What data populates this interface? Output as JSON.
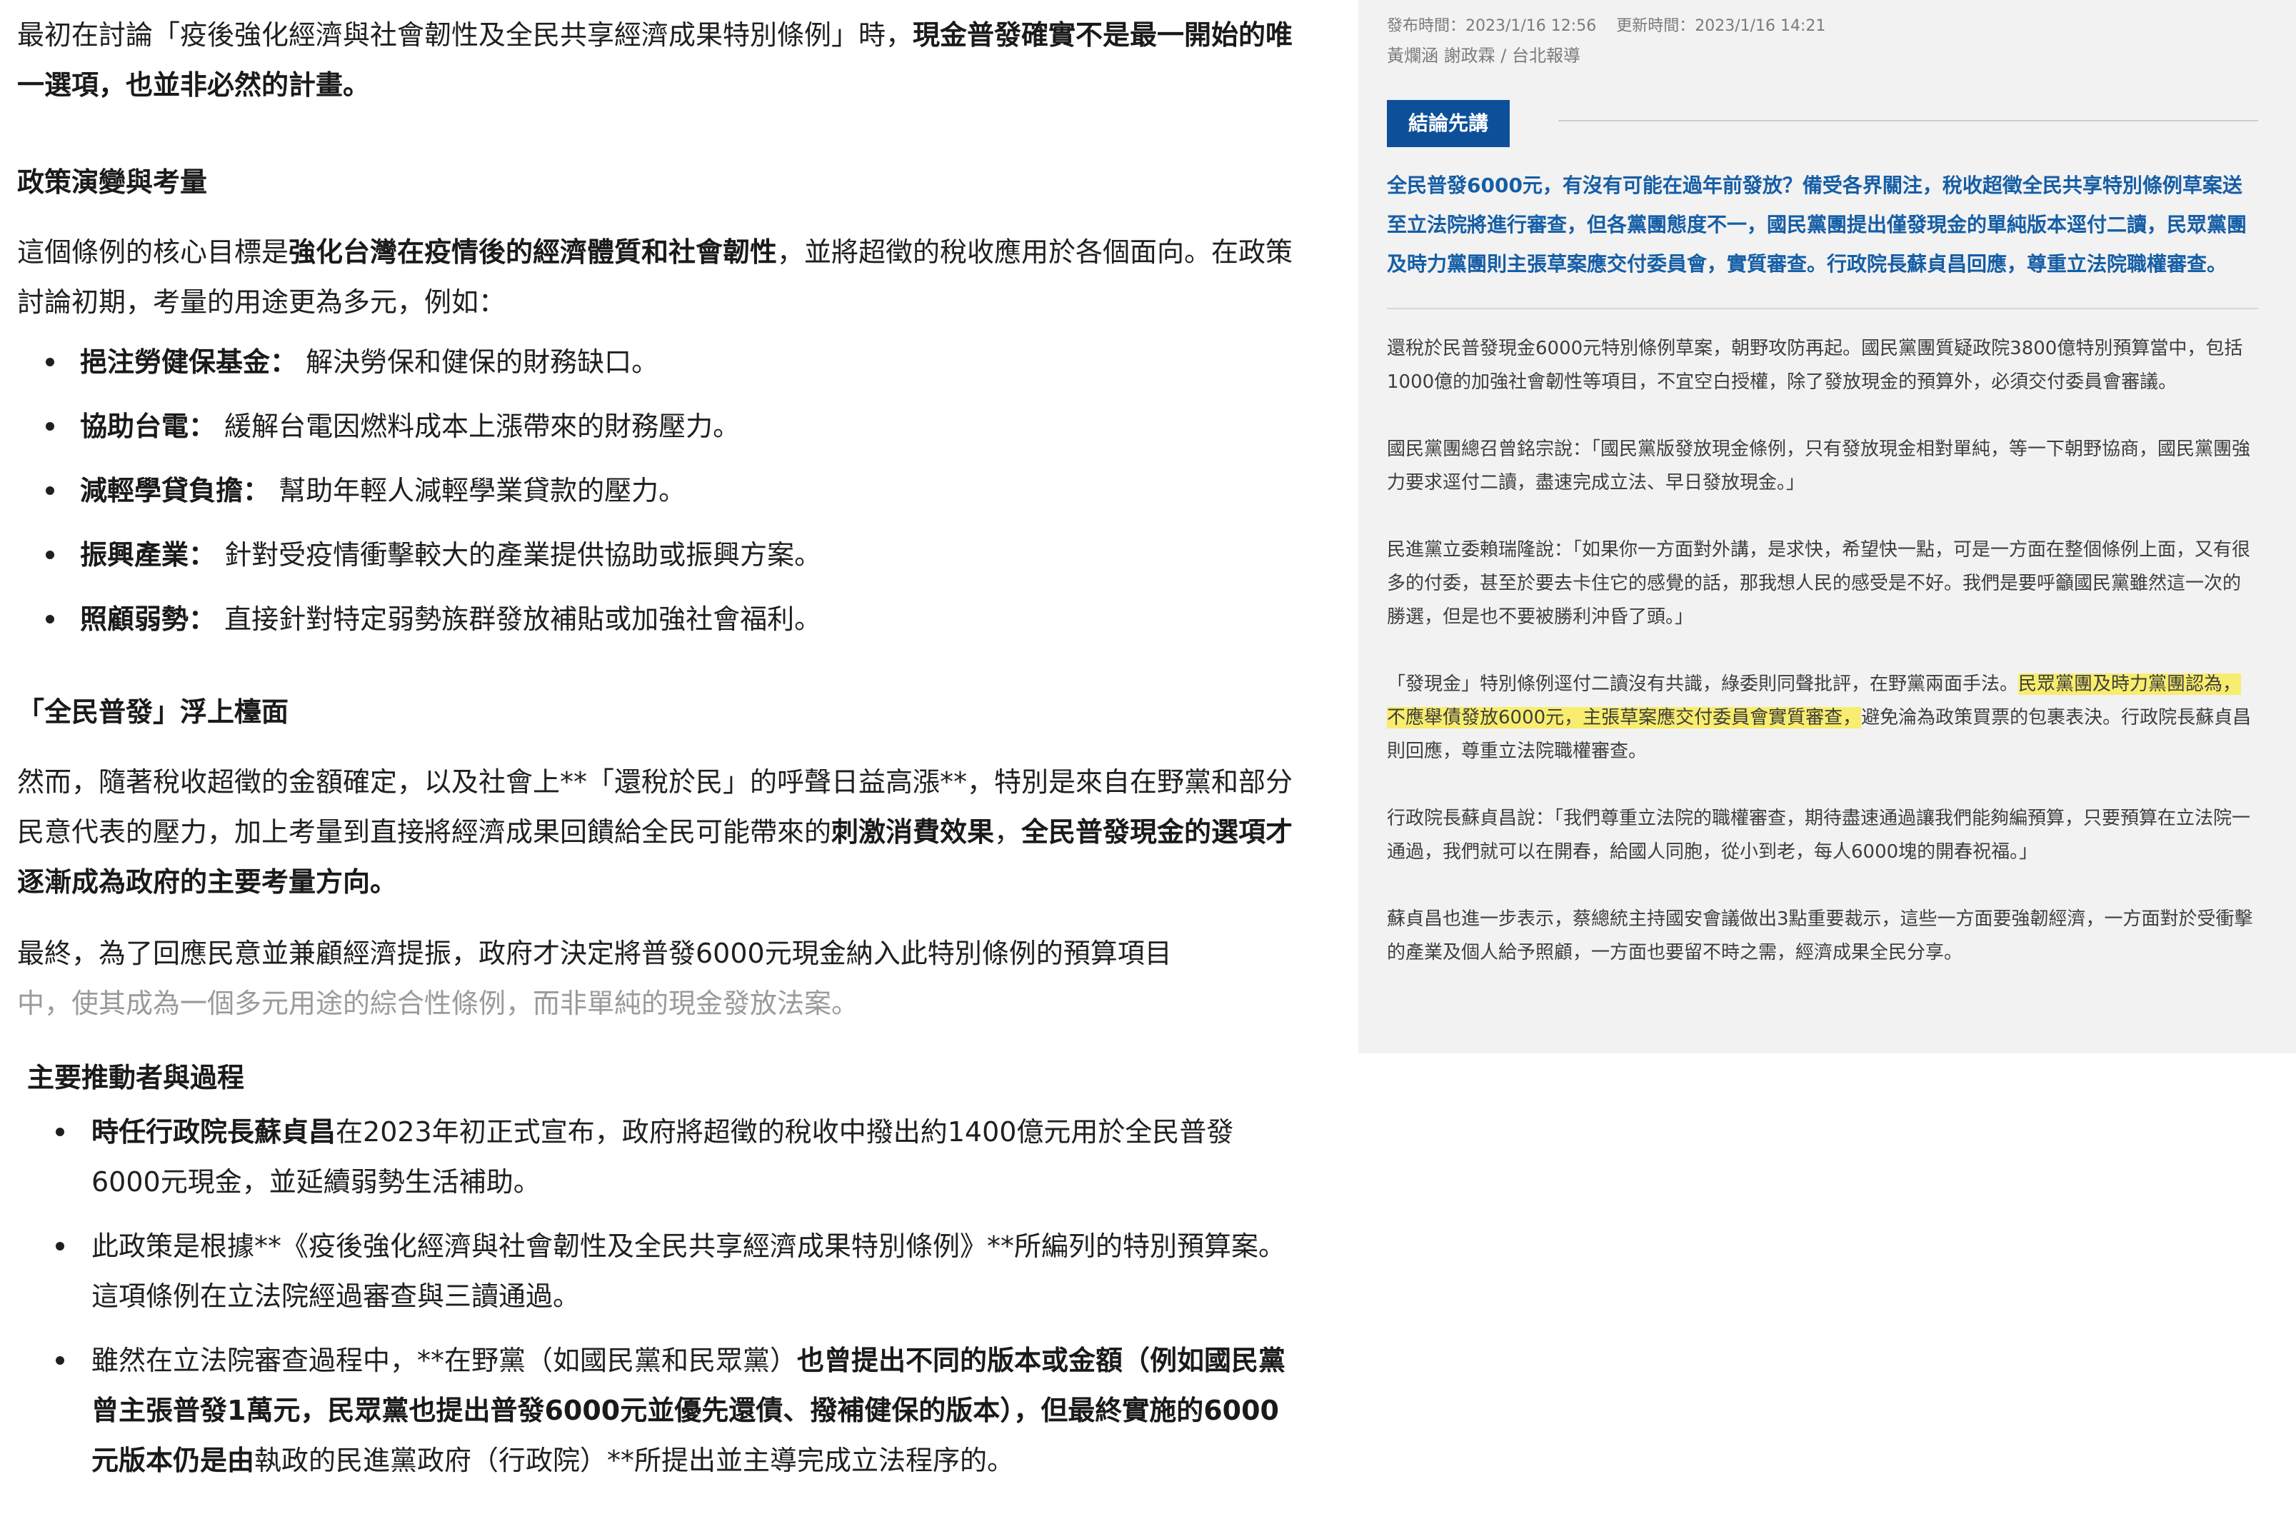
{
  "left": {
    "intro": [
      {
        "t": "最初在討論「疫後強化經濟與社會韌性及全民共享經濟成果特別條例」時，",
        "b": false
      },
      {
        "t": "現金普發確實不是最一開始的唯一選項，也並非必然的計畫。",
        "b": true
      }
    ],
    "h_policy": "政策演變與考量",
    "policy_p": [
      {
        "t": "這個條例的核心目標是",
        "b": false
      },
      {
        "t": "強化台灣在疫情後的經濟體質和社會韌性",
        "b": true
      },
      {
        "t": "，並將超徵的稅收應用於各個面向。在政策討論初期，考量的用途更為多元，例如：",
        "b": false
      }
    ],
    "uses": [
      {
        "label": "挹注勞健保基金：",
        "text": "解決勞保和健保的財務缺口。"
      },
      {
        "label": "協助台電：",
        "text": "緩解台電因燃料成本上漲帶來的財務壓力。"
      },
      {
        "label": "減輕學貸負擔：",
        "text": "幫助年輕人減輕學業貸款的壓力。"
      },
      {
        "label": "振興產業：",
        "text": "針對受疫情衝擊較大的產業提供協助或振興方案。"
      },
      {
        "label": "照顧弱勢：",
        "text": "直接針對特定弱勢族群發放補貼或加強社會福利。"
      }
    ],
    "h_universal": "「全民普發」浮上檯面",
    "universal_p": [
      {
        "t": "然而，隨著稅收超徵的金額確定，以及社會上**「還稅於民」的呼聲日益高漲**，特別是來自在野黨和部分民意代表的壓力，加上考量到直接將經濟成果回饋給全民可能帶來的",
        "b": false
      },
      {
        "t": "刺激消費效果",
        "b": true
      },
      {
        "t": "，",
        "b": false
      },
      {
        "t": "全民普發現金的選項才逐漸成為政府的主要考量方向。",
        "b": true
      }
    ],
    "final_p1": "最終，為了回應民意並兼顧經濟提振，政府才決定將普發6000元現金納入此特別條例的預算項目",
    "final_p2": "中，使其成為一個多元用途的綜合性條例，而非單純的現金發放法案。",
    "h_actors": "主要推動者與過程",
    "actors": [
      [
        {
          "t": "時任行政院長蘇貞昌",
          "b": true
        },
        {
          "t": "在2023年初正式宣布，政府將超徵的稅收中撥出約1400億元用於全民普發6000元現金，並延續弱勢生活補助。",
          "b": false
        }
      ],
      [
        {
          "t": "此政策是根據**《疫後強化經濟與社會韌性及全民共享經濟成果特別條例》**所編列的特別預算案。這項條例在立法院經過審查與三讀通過。",
          "b": false
        }
      ],
      [
        {
          "t": "雖然在立法院審查過程中，**在野黨（如國民黨和民眾黨）",
          "b": false
        },
        {
          "t": "也曾提出不同的版本或金額（例如國民黨曾主張普發1萬元，民眾黨也提出普發6000元並優先還債、撥補健保的版本），但最終實施的6000元版本仍是由",
          "b": true
        },
        {
          "t": "執政的民進黨政府（行政院）**所提出並主導完成立法程序的。",
          "b": false
        }
      ]
    ]
  },
  "right": {
    "meta_publish": "發布時間：2023/1/16 12:56",
    "meta_update": "更新時間：2023/1/16 14:21",
    "byline": "黃爛涵 謝政霖 / 台北報導",
    "conclusion_label": "結論先講",
    "summary": "全民普發6000元，有沒有可能在過年前發放？備受各界關注，稅收超徵全民共享特別條例草案送至立法院將進行審查，但各黨團態度不一，國民黨團提出僅發現金的單純版本逕付二讀，民眾黨團及時力黨團則主張草案應交付委員會，實質審查。行政院長蘇貞昌回應，尊重立法院職權審查。",
    "paras": [
      [
        {
          "t": "還稅於民普發現金6000元特別條例草案，朝野攻防再起。國民黨團質疑政院3800億特別預算當中，包括1000億的加強社會韌性等項目，不宜空白授權，除了發放現金的預算外，必須交付委員會審議。",
          "h": false
        }
      ],
      [
        {
          "t": "國民黨團總召曾銘宗說：「國民黨版發放現金條例，只有發放現金相對單純，等一下朝野協商，國民黨團強力要求逕付二讀，盡速完成立法、早日發放現金。」",
          "h": false
        }
      ],
      [
        {
          "t": "民進黨立委賴瑞隆說：「如果你一方面對外講，是求快，希望快一點，可是一方面在整個條例上面，又有很多的付委，甚至於要去卡住它的感覺的話，那我想人民的感受是不好。我們是要呼籲國民黨雖然這一次的勝選，但是也不要被勝利沖昏了頭。」",
          "h": false
        }
      ],
      [
        {
          "t": "「發現金」特別條例逕付二讀沒有共識，綠委則同聲批評，在野黨兩面手法。",
          "h": false
        },
        {
          "t": "民眾黨團及時力黨團認為，不應舉債發放6000元，主張草案應交付委員會實質審查，",
          "h": true
        },
        {
          "t": "避免淪為政策買票的包裹表決。行政院長蘇貞昌則回應，尊重立法院職權審查。",
          "h": false
        }
      ],
      [
        {
          "t": "行政院長蘇貞昌說：「我們尊重立法院的職權審查，期待盡速通過讓我們能夠編預算，只要預算在立法院一通過，我們就可以在開春，給國人同胞，從小到老，每人6000塊的開春祝福。」",
          "h": false
        }
      ],
      [
        {
          "t": "蘇貞昌也進一步表示，蔡總統主持國安會議做出3點重要裁示，這些一方面要強韌經濟，一方面對於受衝擊的產業及個人給予照顧，一方面也要留不時之需，經濟成果全民分享。",
          "h": false
        }
      ]
    ]
  }
}
